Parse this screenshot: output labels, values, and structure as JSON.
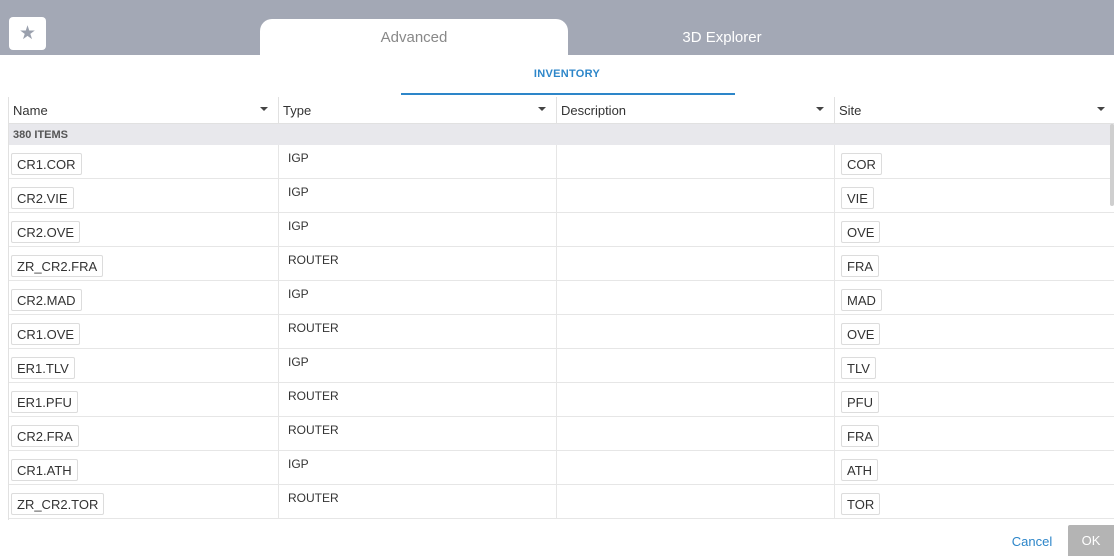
{
  "header": {
    "favorite_icon": "star-icon",
    "tabs": [
      {
        "label": "Advanced",
        "active": true
      },
      {
        "label": "3D Explorer",
        "active": false
      }
    ]
  },
  "section": {
    "title": "INVENTORY"
  },
  "table": {
    "columns": [
      {
        "label": "Name"
      },
      {
        "label": "Type"
      },
      {
        "label": "Description"
      },
      {
        "label": "Site"
      }
    ],
    "count_label": "380 ITEMS",
    "rows": [
      {
        "name": "CR1.COR",
        "type": "IGP",
        "description": "",
        "site": "COR"
      },
      {
        "name": "CR2.VIE",
        "type": "IGP",
        "description": "",
        "site": "VIE"
      },
      {
        "name": "CR2.OVE",
        "type": "IGP",
        "description": "",
        "site": "OVE"
      },
      {
        "name": "ZR_CR2.FRA",
        "type": "ROUTER",
        "description": "",
        "site": "FRA"
      },
      {
        "name": "CR2.MAD",
        "type": "IGP",
        "description": "",
        "site": "MAD"
      },
      {
        "name": "CR1.OVE",
        "type": "ROUTER",
        "description": "",
        "site": "OVE"
      },
      {
        "name": "ER1.TLV",
        "type": "IGP",
        "description": "",
        "site": "TLV"
      },
      {
        "name": "ER1.PFU",
        "type": "ROUTER",
        "description": "",
        "site": "PFU"
      },
      {
        "name": "CR2.FRA",
        "type": "ROUTER",
        "description": "",
        "site": "FRA"
      },
      {
        "name": "CR1.ATH",
        "type": "IGP",
        "description": "",
        "site": "ATH"
      },
      {
        "name": "ZR_CR2.TOR",
        "type": "ROUTER",
        "description": "",
        "site": "TOR"
      }
    ]
  },
  "footer": {
    "cancel_label": "Cancel",
    "ok_label": "OK"
  },
  "colors": {
    "accent": "#2d86c9",
    "tabbar": "#a3a8b5",
    "ok_disabled": "#b4b4b4"
  }
}
